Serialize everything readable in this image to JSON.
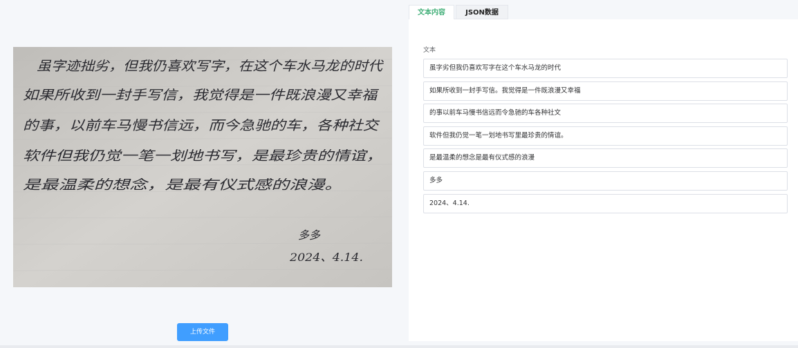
{
  "tabs": {
    "text_tab": "文本内容",
    "json_tab": "JSON数据"
  },
  "upload_button": "上传文件",
  "text_panel": {
    "label": "文本",
    "lines": [
      "虽字劣但我仍喜欢写字在这个车水马龙的时代",
      "如果所收到一封手写信。我觉得是一件既浪漫又幸福",
      "的事以前车马慢书信远而令急驰的车各种社文",
      "软件但我仍觉一笔一划地书写里最珍贵的情谊。",
      "是最温柔的想念是最有仪式感的浪漫",
      "多多",
      "2024、4.14."
    ]
  },
  "handwriting_image": {
    "lines": [
      "虽字迹拙劣，但我仍喜欢写字，在这个车水马龙的时代",
      "如果所收到一封手写信，我觉得是一件既浪漫又幸福",
      "的事，以前车马慢书信远，而今急驰的车，各种社交",
      "软件但我仍觉一笔一划地书写，是最珍贵的情谊，",
      "是最温柔的想念，是最有仪式感的浪漫。",
      "多多",
      "2024、4.14."
    ]
  }
}
